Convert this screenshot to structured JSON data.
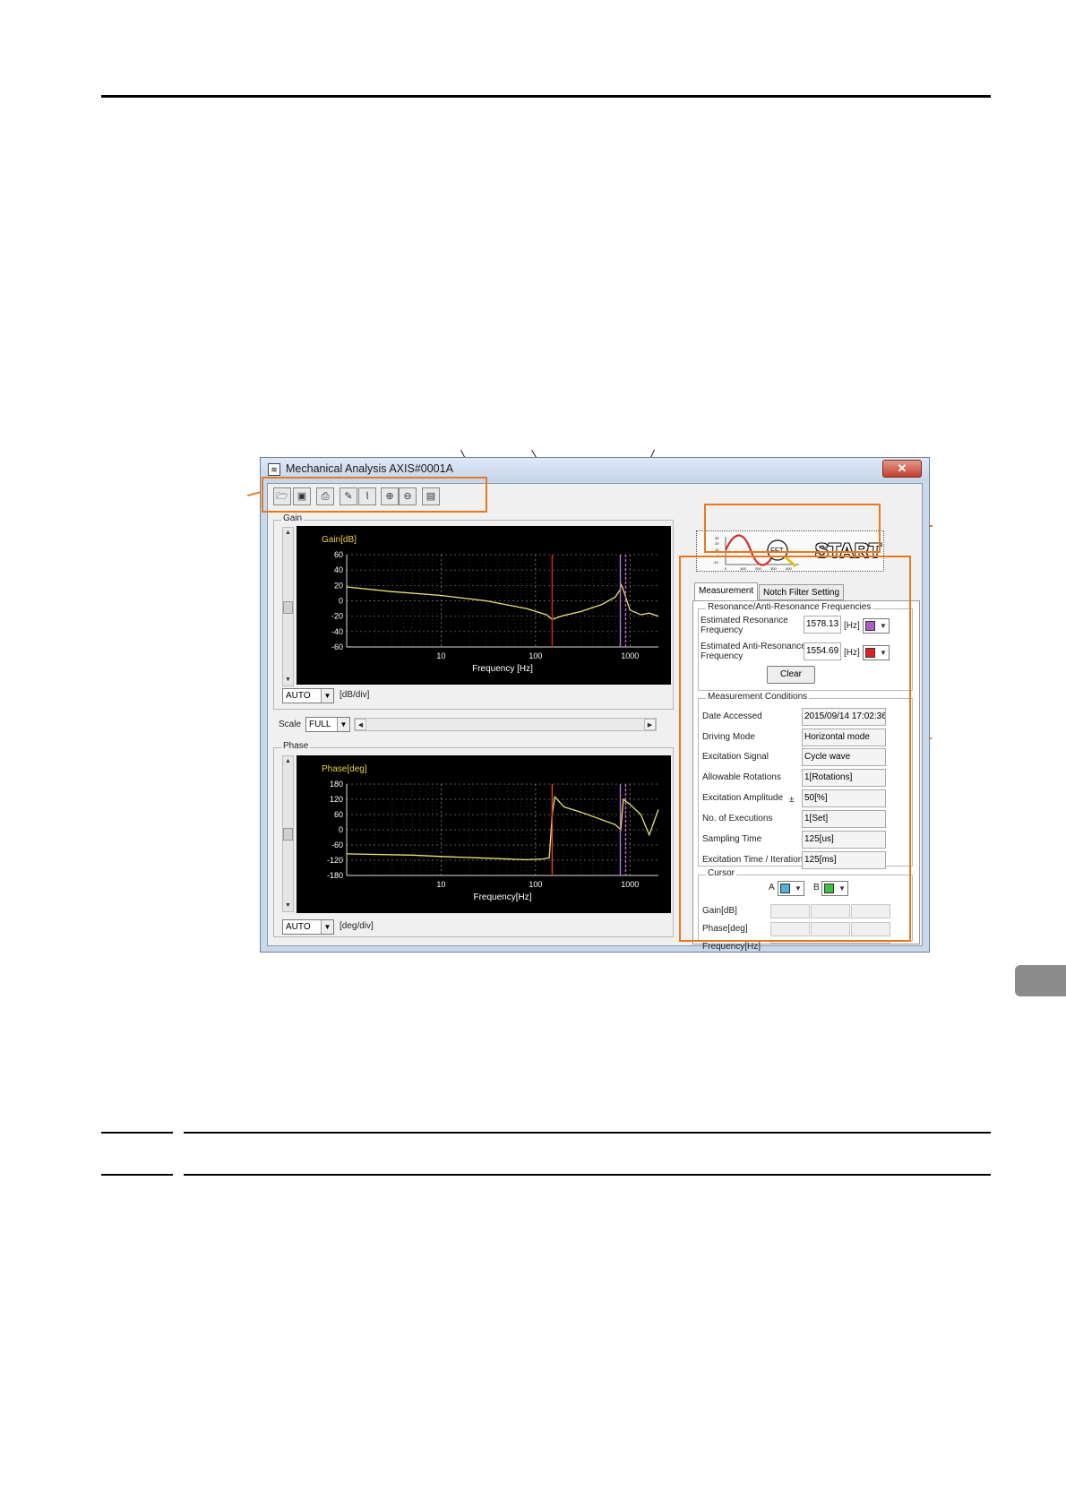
{
  "window": {
    "title": "Mechanical Analysis AXIS#0001A",
    "close_label": "✕"
  },
  "toolbar": {
    "icons": [
      "open-icon",
      "save-icon",
      "print-icon",
      "paste-icon",
      "waveform-icon",
      "zoom-in-icon",
      "zoom-out-icon",
      "image-icon"
    ]
  },
  "gain": {
    "group_label": "Gain",
    "scale_value": "AUTO",
    "unit_label": "[dB/div]"
  },
  "scale": {
    "label": "Scale",
    "value": "FULL"
  },
  "phase": {
    "group_label": "Phase",
    "scale_value": "AUTO",
    "unit_label": "[deg/div]"
  },
  "start_button": {
    "label": "START",
    "thumb_y_ticks": [
      "30",
      "20",
      "10",
      "0",
      "-10"
    ],
    "thumb_x_ticks": [
      "0",
      "100",
      "200",
      "300",
      "400"
    ],
    "fft_label": "FFT"
  },
  "tabs": [
    {
      "label": "Measurement",
      "active": true
    },
    {
      "label": "Notch Filter Setting",
      "active": false
    }
  ],
  "resonance": {
    "group_label": "Resonance/Anti-Resonance Frequencies",
    "resonance_label_1": "Estimated Resonance",
    "resonance_label_2": "Frequency",
    "resonance_value": "1578.13",
    "anti_label_1": "Estimated Anti-Resonance",
    "anti_label_2": "Frequency",
    "anti_value": "1554.69",
    "unit": "[Hz]",
    "resonance_color": "#b05cc8",
    "anti_color": "#e02020",
    "clear_label": "Clear"
  },
  "conditions": {
    "group_label": "Measurement Conditions",
    "pm_sign": "±",
    "rows": [
      {
        "label": "Date Accessed",
        "value": "2015/09/14 17:02:36"
      },
      {
        "label": "Driving Mode",
        "value": "Horizontal mode"
      },
      {
        "label": "Excitation Signal",
        "value": "Cycle wave"
      },
      {
        "label": "Allowable Rotations",
        "value": "1[Rotations]"
      },
      {
        "label": "Excitation Amplitude",
        "value": "50[%]"
      },
      {
        "label": "No. of Executions",
        "value": "1[Set]"
      },
      {
        "label": "Sampling Time",
        "value": "125[us]"
      },
      {
        "label": "Excitation Time / Iteration",
        "value": "125[ms]"
      }
    ]
  },
  "cursor": {
    "group_label": "Cursor",
    "a_label": "A",
    "b_label": "B",
    "a_color": "#4fb3d9",
    "b_color": "#3fbf3f",
    "row_labels": [
      "Gain[dB]",
      "Phase[deg]",
      "Frequency[Hz]"
    ]
  },
  "chart_data": [
    {
      "type": "line",
      "title": "Gain[dB]",
      "xlabel": "Frequency [Hz]",
      "ylabel": "Gain[dB]",
      "x_scale": "log",
      "xlim": [
        1,
        2000
      ],
      "ylim": [
        -60,
        60
      ],
      "x_ticks": [
        "10",
        "100",
        "1000"
      ],
      "y_ticks": [
        "60",
        "40",
        "20",
        "0",
        "-20",
        "-40",
        "-60"
      ],
      "grid": true,
      "series": [
        {
          "color": "#e6e67a",
          "x": [
            1,
            3,
            10,
            30,
            80,
            130,
            150,
            200,
            300,
            500,
            700,
            790,
            800,
            830,
            1000,
            1300,
            1600,
            2000
          ],
          "y": [
            18,
            12,
            7,
            0,
            -10,
            -18,
            -24,
            -19,
            -14,
            -5,
            5,
            15,
            22,
            18,
            -12,
            -18,
            -16,
            -20
          ]
        }
      ],
      "markers_x": [
        150,
        790,
        900
      ],
      "marker_colors": [
        "#e02020",
        "#c070d8",
        "#c070d8"
      ]
    },
    {
      "type": "line",
      "title": "Phase[deg]",
      "xlabel": "Frequency[Hz]",
      "ylabel": "Phase[deg]",
      "x_scale": "log",
      "xlim": [
        1,
        2000
      ],
      "ylim": [
        -180,
        180
      ],
      "x_ticks": [
        "10",
        "100",
        "1000"
      ],
      "y_ticks": [
        "180",
        "120",
        "60",
        "0",
        "-60",
        "-120",
        "-180"
      ],
      "grid": true,
      "series": [
        {
          "color": "#e6e67a",
          "x": [
            1,
            5,
            10,
            30,
            80,
            120,
            140,
            150,
            160,
            200,
            300,
            500,
            700,
            800,
            850,
            1000,
            1300,
            1600,
            2000
          ],
          "y": [
            -95,
            -100,
            -105,
            -112,
            -118,
            -115,
            -110,
            60,
            130,
            90,
            70,
            40,
            20,
            0,
            120,
            100,
            60,
            -20,
            80
          ]
        }
      ],
      "markers_x": [
        150,
        790,
        900
      ],
      "marker_colors": [
        "#e04020",
        "#c070d8",
        "#c070d8"
      ]
    }
  ]
}
